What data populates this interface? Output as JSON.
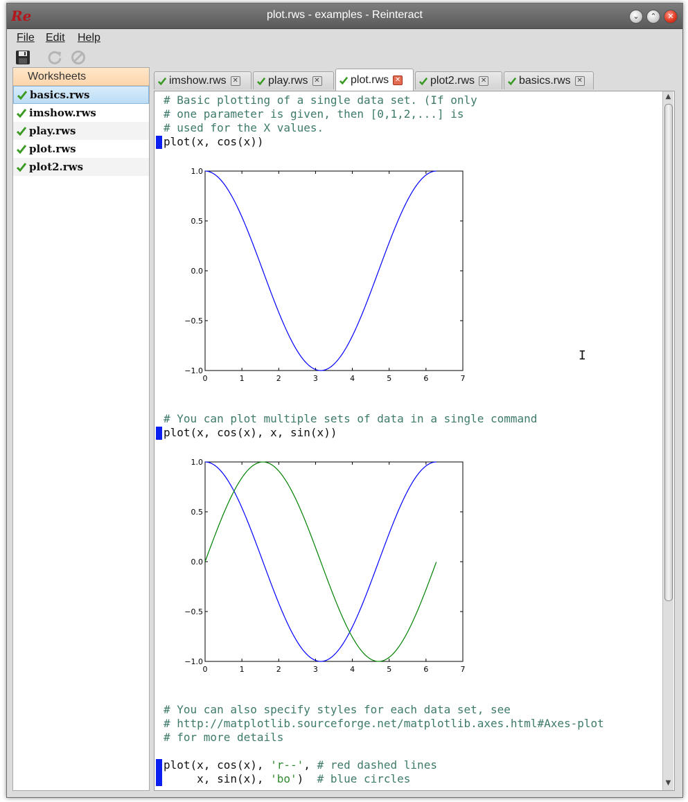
{
  "window": {
    "title": "plot.rws - examples - Reinteract",
    "logo_text": "Re"
  },
  "window_controls": {
    "minimize": "⌄",
    "maximize": "⌃",
    "close": "✕"
  },
  "menu": [
    {
      "label": "File"
    },
    {
      "label": "Edit"
    },
    {
      "label": "Help"
    }
  ],
  "toolbar": {
    "icons": [
      "save-icon",
      "refresh-icon",
      "stop-icon"
    ]
  },
  "sidebar": {
    "header": "Worksheets",
    "items": [
      {
        "label": "basics.rws",
        "selected": true
      },
      {
        "label": "imshow.rws"
      },
      {
        "label": "play.rws"
      },
      {
        "label": "plot.rws"
      },
      {
        "label": "plot2.rws"
      }
    ]
  },
  "tabs": [
    {
      "label": "imshow.rws"
    },
    {
      "label": "play.rws"
    },
    {
      "label": "plot.rws",
      "active": true
    },
    {
      "label": "plot2.rws"
    },
    {
      "label": "basics.rws"
    }
  ],
  "editor": {
    "comment1": [
      "# Basic plotting of a single data set. (If only",
      "# one parameter is given, then [0,1,2,...] is",
      "# used for the X values."
    ],
    "stmt1": "plot(x, cos(x))",
    "comment2": "# You can plot multiple sets of data in a single command",
    "stmt2": "plot(x, cos(x), x, sin(x))",
    "comment3": [
      "# You can also specify styles for each data set, see",
      "# http://matplotlib.sourceforge.net/matplotlib.axes.html#Axes-plot",
      "# for more details"
    ],
    "stmt3": {
      "line1_a": "plot(x, cos(x), ",
      "line1_str": "'r--'",
      "line1_b": ", ",
      "line1_comment": "# red dashed lines",
      "line2_a": "     x, sin(x), ",
      "line2_str": "'bo'",
      "line2_b": ")  ",
      "line2_comment": "# blue circles"
    }
  },
  "colors": {
    "marker": "#0a1ef0",
    "series_blue": "#0000ff",
    "series_green": "#008000",
    "comment": "#3d7a6a"
  },
  "chart_data": [
    {
      "type": "line",
      "xlim": [
        0,
        7
      ],
      "ylim": [
        -1.0,
        1.0
      ],
      "xticks": [
        "0",
        "1",
        "2",
        "3",
        "4",
        "5",
        "6",
        "7"
      ],
      "yticks": [
        "1.0",
        "0.5",
        "0.0",
        "−0.5",
        "−1.0"
      ],
      "series": [
        {
          "function": "cos",
          "x_range": [
            0,
            6.28
          ],
          "color": "#0000ff"
        }
      ]
    },
    {
      "type": "line",
      "xlim": [
        0,
        7
      ],
      "ylim": [
        -1.0,
        1.0
      ],
      "xticks": [
        "0",
        "1",
        "2",
        "3",
        "4",
        "5",
        "6",
        "7"
      ],
      "yticks": [
        "1.0",
        "0.5",
        "0.0",
        "−0.5",
        "−1.0"
      ],
      "series": [
        {
          "function": "cos",
          "x_range": [
            0,
            6.28
          ],
          "color": "#0000ff"
        },
        {
          "function": "sin",
          "x_range": [
            0,
            6.28
          ],
          "color": "#008000"
        }
      ]
    }
  ]
}
